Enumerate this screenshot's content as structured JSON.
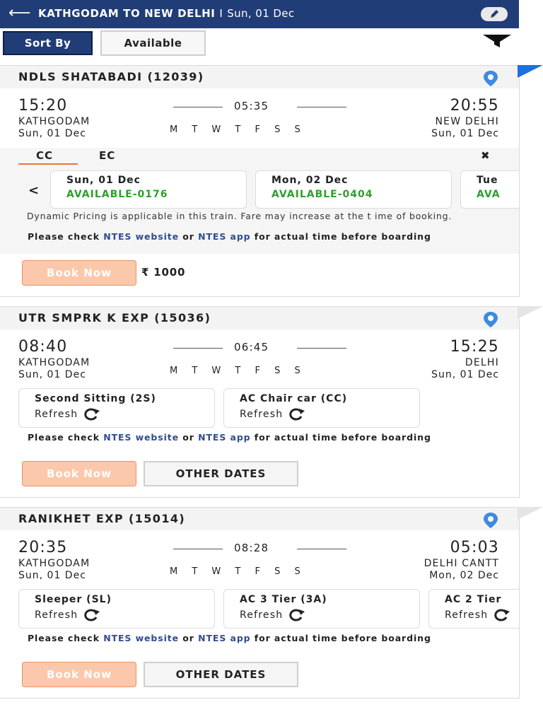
{
  "header": {
    "back_icon": "back-arrow-icon",
    "route": "KATHGODAM TO NEW DELHI",
    "separator": "I",
    "date": "Sun, 01 Dec",
    "edit_icon": "pencil-icon",
    "bg_color": "#213d77"
  },
  "toolbar": {
    "sort_label": "Sort By",
    "available_label": "Available",
    "filter_icon": "filter-funnel-icon"
  },
  "trains": [
    {
      "name": "NDLS SHATABADI (12039)",
      "dep_time": "15:20",
      "dep_station": "KATHGODAM",
      "dep_date": "Sun, 01 Dec",
      "duration": "05:35",
      "days": "M T W T F S S",
      "arr_time": "20:55",
      "arr_station": "NEW DELHI",
      "arr_date": "Sun, 01 Dec",
      "class_tabs": [
        "CC",
        "EC"
      ],
      "availability": [
        {
          "date": "Sun, 01 Dec",
          "status": "AVAILABLE-0176"
        },
        {
          "date": "Mon, 02 Dec",
          "status": "AVAILABLE-0404"
        },
        {
          "date": "Tue",
          "status": "AVA"
        }
      ],
      "notice": "Dynamic Pricing is applicable in this train. Fare may increase at the t ime of booking.",
      "book_label": "Book Now",
      "fare": "₹ 1000"
    },
    {
      "name": "UTR SMPRK K EXP (15036)",
      "dep_time": "08:40",
      "dep_station": "KATHGODAM",
      "dep_date": "Sun, 01 Dec",
      "duration": "06:45",
      "days": "M T W T F S S",
      "arr_time": "15:25",
      "arr_station": "DELHI",
      "arr_date": "Sun, 01 Dec",
      "classes": [
        {
          "name": "Second Sitting (2S)",
          "refresh": "Refresh"
        },
        {
          "name": "AC Chair car (CC)",
          "refresh": "Refresh"
        }
      ],
      "book_label": "Book Now",
      "other_dates_label": "OTHER DATES"
    },
    {
      "name": "RANIKHET EXP (15014)",
      "dep_time": "20:35",
      "dep_station": "KATHGODAM",
      "dep_date": "Sun, 01 Dec",
      "duration": "08:28",
      "days": "M T W T F S S",
      "arr_time": "05:03",
      "arr_station": "DELHI CANTT",
      "arr_date": "Mon, 02 Dec",
      "classes": [
        {
          "name": "Sleeper (SL)",
          "refresh": "Refresh"
        },
        {
          "name": "AC 3 Tier (3A)",
          "refresh": "Refresh"
        },
        {
          "name": "AC 2 Tier",
          "refresh": "Refresh"
        }
      ],
      "book_label": "Book Now",
      "other_dates_label": "OTHER DATES"
    }
  ],
  "check_notice": {
    "prefix": "Please check ",
    "link1": "NTES website",
    "middle": " or ",
    "link2": "NTES app",
    "suffix": " for actual time before boarding"
  },
  "icons": {
    "location": "location-pin-icon",
    "refresh": "refresh-icon",
    "close": "close-icon",
    "prev": "chevron-left-icon"
  },
  "colors": {
    "primary": "#213d77",
    "accent": "#e8743b",
    "available": "#2ca02c",
    "link": "#2e4d8f",
    "pin": "#3d8ae0"
  }
}
